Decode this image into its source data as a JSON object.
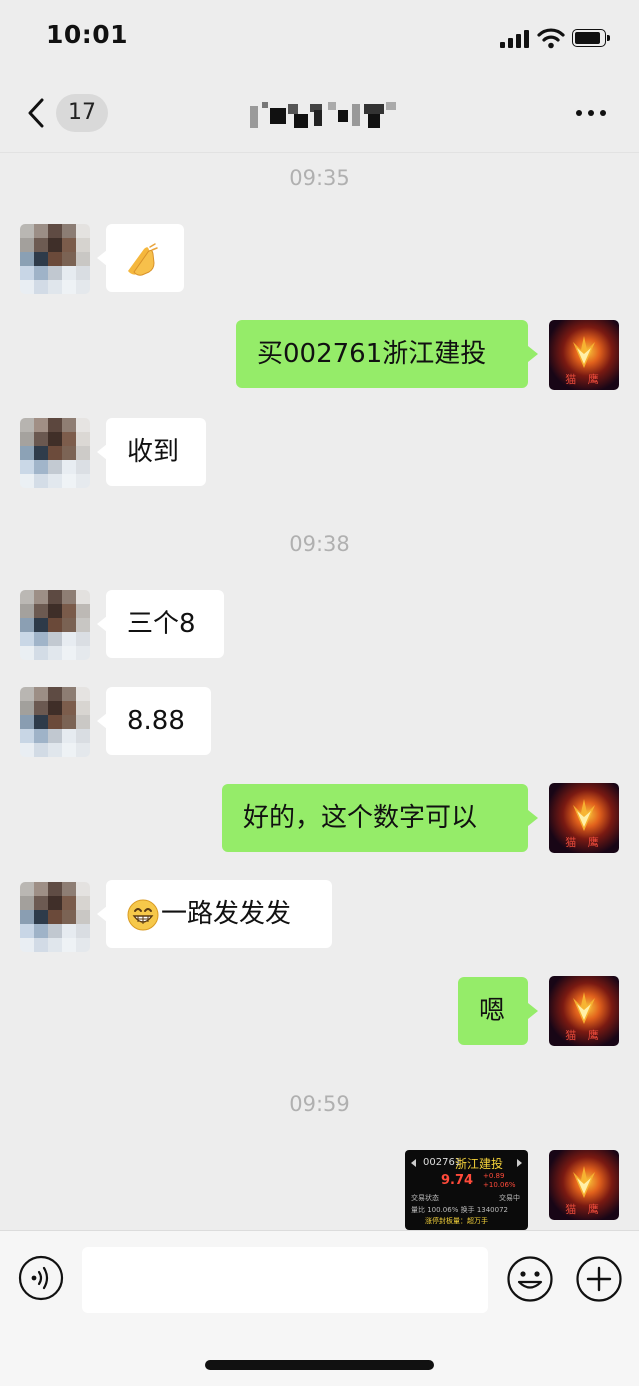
{
  "status_bar": {
    "time": "10:01"
  },
  "nav": {
    "unread_count": "17",
    "title": ""
  },
  "messages": [
    {
      "type": "timestamp",
      "text": "09:35"
    },
    {
      "type": "incoming",
      "emoji": "palms-together",
      "text": ""
    },
    {
      "type": "outgoing",
      "text": "买002761浙江建投"
    },
    {
      "type": "incoming",
      "text": "收到"
    },
    {
      "type": "timestamp",
      "text": "09:38"
    },
    {
      "type": "incoming",
      "text": "三个8"
    },
    {
      "type": "incoming",
      "text": "8.88"
    },
    {
      "type": "outgoing",
      "text": "好的，这个数字可以"
    },
    {
      "type": "incoming",
      "emoji": "grinning-face",
      "text": "一路发发发"
    },
    {
      "type": "outgoing",
      "text": "嗯"
    },
    {
      "type": "timestamp",
      "text": "09:59"
    },
    {
      "type": "outgoing-image",
      "image": {
        "code": "002761",
        "name": "浙江建投",
        "price": "9.74",
        "change_abs": "+0.89",
        "change_pct": "+10.06%",
        "status_label": "交易状态",
        "status_label_right": "交易中",
        "row2": "量比  100.06%  换手  1340072",
        "row3": "涨停封板量：超万手"
      }
    }
  ],
  "input_bar": {
    "placeholder": ""
  },
  "colors": {
    "background": "#ededed",
    "bubble_in": "#ffffff",
    "bubble_out": "#95ec69",
    "timestamp": "#b0b0b0"
  }
}
